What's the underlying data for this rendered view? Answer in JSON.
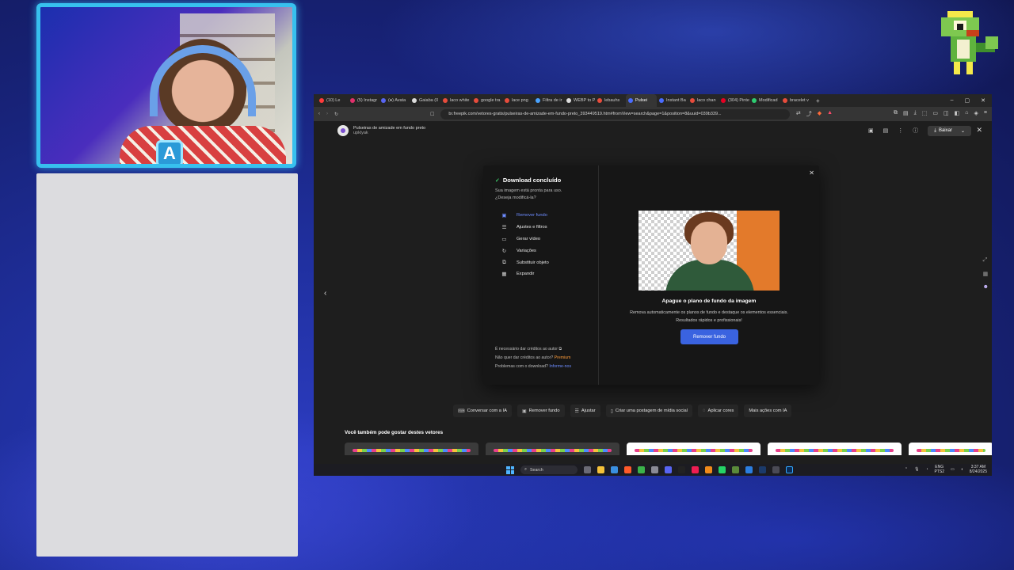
{
  "browser": {
    "tabs": [
      {
        "label": "(10) Le",
        "color": "#ff3b3b"
      },
      {
        "label": "(5) Instagr",
        "color": "#e1306c"
      },
      {
        "label": "(●) Avata",
        "color": "#5865f2"
      },
      {
        "label": "Gaiaba (0",
        "color": "#dddddd"
      },
      {
        "label": "laco white",
        "color": "#e74c3c"
      },
      {
        "label": "google tra",
        "color": "#e74c3c"
      },
      {
        "label": "lace png",
        "color": "#e74c3c"
      },
      {
        "label": "Filtra de ir",
        "color": "#4aa3ff"
      },
      {
        "label": "WEBP to P",
        "color": "#dddddd"
      },
      {
        "label": "lebauhs",
        "color": "#e74c3c"
      },
      {
        "label": "Pulsei",
        "color": "#4a6cff"
      },
      {
        "label": "Instant Ba",
        "color": "#4a6cff"
      },
      {
        "label": "laco chan",
        "color": "#e74c3c"
      },
      {
        "label": "(304) Pinte",
        "color": "#e60023"
      },
      {
        "label": "Modificad",
        "color": "#2ecc71"
      },
      {
        "label": "bracelet v",
        "color": "#e74c3c"
      }
    ],
    "active_tab_index": 10,
    "new_tab": "+",
    "window_controls": {
      "minimize": "–",
      "maximize": "▢",
      "close": "✕"
    },
    "url": "br.freepik.com/vetores-gratis/pulseiras-de-amizade-em-fundo-preto_393449519.htm#fromView=search&page=1&position=8&uuid=039b339..."
  },
  "modal_header": {
    "title": "Pulseiras de amizade em fundo preto",
    "author": "upklyak",
    "download_button": "Baixar",
    "close": "✕"
  },
  "download_dialog": {
    "title": "Download concluído",
    "check_icon": "✓",
    "subtitle_line1": "Sua imagem está pronta para uso.",
    "subtitle_line2": "¿Deseja modificá-la?",
    "menu": [
      {
        "label": "Remover fundo",
        "icon": "▣",
        "icon_name": "remove-background-icon",
        "active": true
      },
      {
        "label": "Ajustes e filtros",
        "icon": "☰",
        "icon_name": "sliders-icon",
        "active": false
      },
      {
        "label": "Gerar vídeo",
        "icon": "▭",
        "icon_name": "video-icon",
        "active": false
      },
      {
        "label": "Variações",
        "icon": "↻",
        "icon_name": "refresh-icon",
        "active": false
      },
      {
        "label": "Substituir objeto",
        "icon": "⧉",
        "icon_name": "replace-object-icon",
        "active": false
      },
      {
        "label": "Expandir",
        "icon": "▦",
        "icon_name": "expand-icon",
        "active": false
      }
    ],
    "footer_line1": "É necessário dar créditos ao autor",
    "footer_copy_icon": "⧉",
    "footer_line2_pre": "Não quer dar créditos ao autor?",
    "footer_premium": "Premium",
    "footer_line3_pre": "Problemas com o download?",
    "footer_report": "Informe-nos",
    "feature_title": "Apague o plano de fundo da imagem",
    "feature_desc_line1": "Remova automaticamente os planos de fundo e destaque os elementos essenciais.",
    "feature_desc_line2": "Resultados rápidos e profissionais!",
    "cta": "Remover fundo",
    "close": "✕"
  },
  "ai_actions": [
    {
      "label": "Conversar com a IA",
      "icon": "⌨"
    },
    {
      "label": "Remover fundo",
      "icon": "▣"
    },
    {
      "label": "Ajustar",
      "icon": "☰"
    },
    {
      "label": "Criar uma postagem de mídia social",
      "icon": "▯"
    },
    {
      "label": "Aplicar cores",
      "icon": "◌"
    },
    {
      "label": "Mais ações com IA",
      "icon": ""
    }
  ],
  "related": {
    "title": "Você também pode gostar destes vetores"
  },
  "taskbar": {
    "search_placeholder": "Search",
    "lang_top": "ENG",
    "lang_bottom": "PTS2",
    "time": "3:37 AM",
    "date": "8/24/2025"
  }
}
